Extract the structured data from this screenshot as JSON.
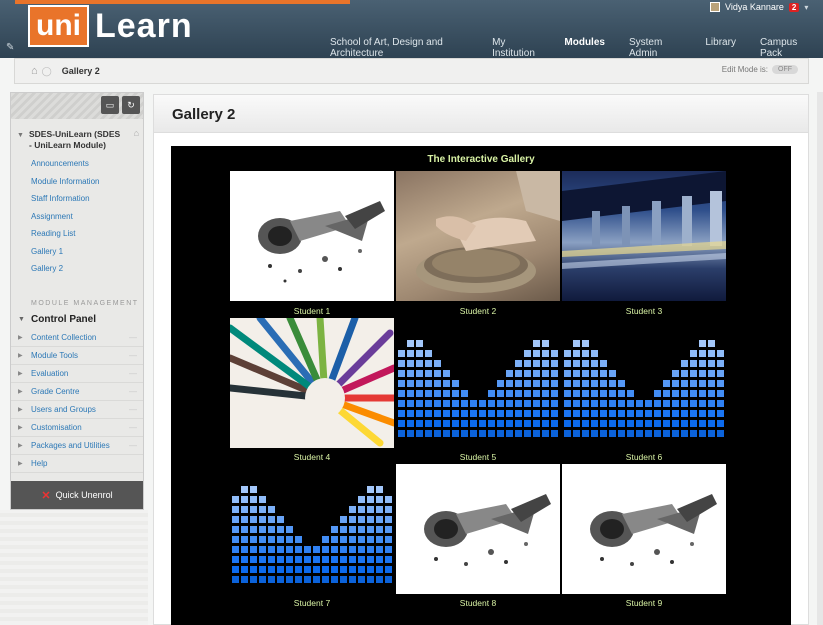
{
  "header": {
    "logo_uni": "uni",
    "logo_learn": "Learn",
    "user_name": "Vidya Kannare",
    "notification_count": "2",
    "nav": [
      {
        "label": "School of Art, Design and Architecture",
        "active": false
      },
      {
        "label": "My Institution",
        "active": false
      },
      {
        "label": "Modules",
        "active": true
      },
      {
        "label": "System Admin",
        "active": false
      },
      {
        "label": "Library",
        "active": false
      },
      {
        "label": "Campus Pack",
        "active": false
      }
    ]
  },
  "breadcrumb": {
    "current": "Gallery 2",
    "edit_mode_label": "Edit Mode is:",
    "edit_mode_value": "OFF"
  },
  "sidebar": {
    "course_title": "SDES-UniLearn (SDES - UniLearn Module)",
    "links": [
      "Announcements",
      "Module Information",
      "Staff Information",
      "Assignment",
      "Reading List",
      "Gallery 1",
      "Gallery 2"
    ],
    "module_management": "MODULE MANAGEMENT",
    "control_panel": "Control Panel",
    "cp_items": [
      "Content Collection",
      "Module Tools",
      "Evaluation",
      "Grade Centre",
      "Users and Groups",
      "Customisation",
      "Packages and Utilities",
      "Help"
    ],
    "quick_unenrol": "Quick Unenrol"
  },
  "main": {
    "page_title": "Gallery 2",
    "gallery_title": "The Interactive Gallery",
    "students": [
      "Student 1",
      "Student 2",
      "Student 3",
      "Student 4",
      "Student 5",
      "Student 6",
      "Student 7",
      "Student 8",
      "Student 9"
    ]
  },
  "colors": {
    "accent_orange": "#e9742a",
    "link_blue": "#2c78b6",
    "caption_green": "#d9f3a5"
  }
}
